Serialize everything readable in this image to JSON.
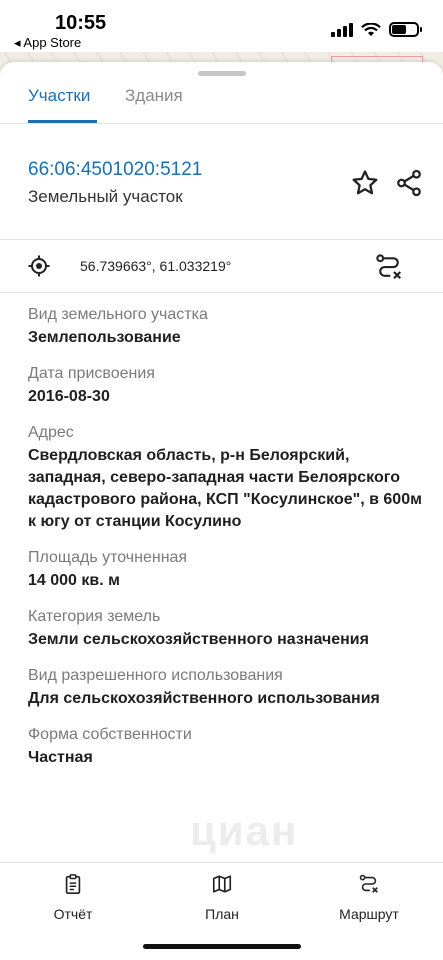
{
  "status_bar": {
    "time": "10:55",
    "back_app": "◂ App Store"
  },
  "tabs": [
    {
      "label": "Участки",
      "active": true
    },
    {
      "label": "Здания",
      "active": false
    }
  ],
  "parcel": {
    "cadastral_number": "66:06:4501020:5121",
    "object_type": "Земельный участок",
    "coordinates": "56.739663°, 61.033219°"
  },
  "fields": [
    {
      "label": "Вид земельного участка",
      "value": "Землепользование"
    },
    {
      "label": "Дата присвоения",
      "value": "2016-08-30"
    },
    {
      "label": "Адрес",
      "value": "Свердловская область, р-н Белоярский, западная, северо-западная части Белоярского кадастрового района, КСП \"Косулинское\", в 600м к югу от станции Косулино"
    },
    {
      "label": "Площадь уточненная",
      "value": "14 000 кв. м"
    },
    {
      "label": "Категория земель",
      "value": "Земли сельскохозяйственного назначения"
    },
    {
      "label": "Вид разрешенного использования",
      "value": "Для сельскохозяйственного использования"
    },
    {
      "label": "Форма собственности",
      "value": "Частная"
    }
  ],
  "watermark": "циан",
  "bottom_bar": {
    "report_label": "Отчёт",
    "plan_label": "План",
    "route_label": "Маршрут"
  },
  "colors": {
    "accent": "#1a6fb5",
    "label": "#7a7a7a"
  },
  "icons": [
    "star-icon",
    "share-icon",
    "locate-icon",
    "route-icon",
    "report-icon",
    "map-icon"
  ]
}
